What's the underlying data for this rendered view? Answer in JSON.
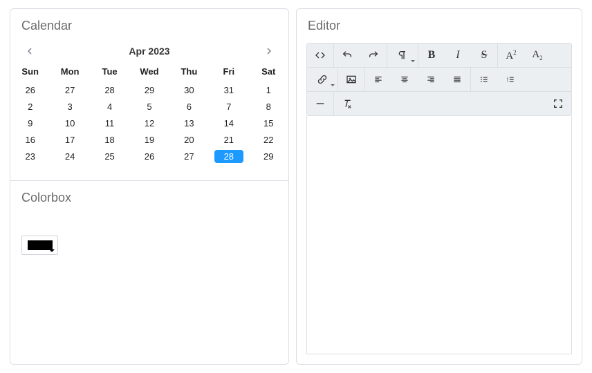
{
  "calendar": {
    "title": "Calendar",
    "month_label": "Apr 2023",
    "weekdays": [
      "Sun",
      "Mon",
      "Tue",
      "Wed",
      "Thu",
      "Fri",
      "Sat"
    ],
    "weeks": [
      [
        {
          "d": 26,
          "out": true
        },
        {
          "d": 27,
          "out": true
        },
        {
          "d": 28,
          "out": true
        },
        {
          "d": 29,
          "out": true
        },
        {
          "d": 30,
          "out": true
        },
        {
          "d": 31,
          "out": true
        },
        {
          "d": 1
        }
      ],
      [
        {
          "d": 2
        },
        {
          "d": 3
        },
        {
          "d": 4
        },
        {
          "d": 5
        },
        {
          "d": 6
        },
        {
          "d": 7
        },
        {
          "d": 8
        }
      ],
      [
        {
          "d": 9
        },
        {
          "d": 10
        },
        {
          "d": 11
        },
        {
          "d": 12
        },
        {
          "d": 13
        },
        {
          "d": 14
        },
        {
          "d": 15
        }
      ],
      [
        {
          "d": 16
        },
        {
          "d": 17
        },
        {
          "d": 18
        },
        {
          "d": 19
        },
        {
          "d": 20
        },
        {
          "d": 21
        },
        {
          "d": 22
        }
      ],
      [
        {
          "d": 23
        },
        {
          "d": 24
        },
        {
          "d": 25
        },
        {
          "d": 26
        },
        {
          "d": 27
        },
        {
          "d": 28,
          "sel": true
        },
        {
          "d": 29
        }
      ]
    ]
  },
  "colorbox": {
    "title": "Colorbox",
    "value": "#000000"
  },
  "editor": {
    "title": "Editor",
    "content": ""
  }
}
